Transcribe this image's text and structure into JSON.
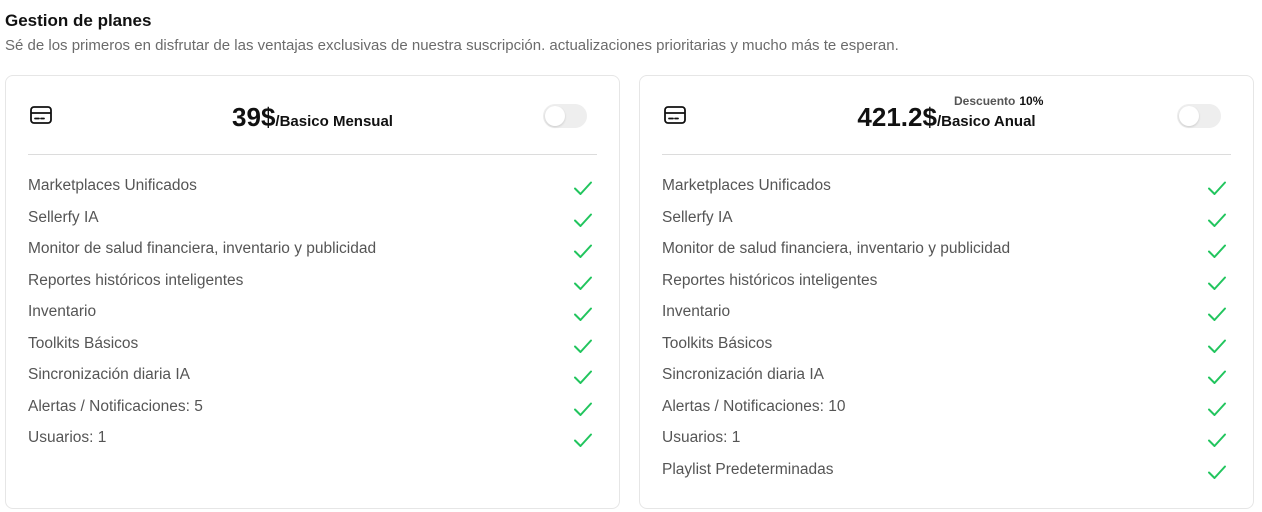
{
  "page": {
    "title": "Gestion de planes",
    "subtitle": "Sé de los primeros en disfrutar de las ventajas exclusivas de nuestra suscripción. actualizaciones prioritarias y mucho más te esperan."
  },
  "colors": {
    "check": "#22c55e",
    "toggle_off": "#eeeeee"
  },
  "plans": [
    {
      "icon": "credit-card-icon",
      "price": "39$",
      "period": "/Basico Mensual",
      "toggle_on": false,
      "features": [
        "Marketplaces Unificados",
        "Sellerfy IA",
        "Monitor de salud financiera, inventario y publicidad",
        "Reportes históricos inteligentes",
        "Inventario",
        "Toolkits Básicos",
        "Sincronización diaria IA",
        "Alertas / Notificaciones: 5",
        "Usuarios: 1"
      ]
    },
    {
      "icon": "credit-card-icon",
      "price": "421.2$",
      "period": "/Basico Anual",
      "discount_label": "Descuento",
      "discount_value": "10%",
      "toggle_on": false,
      "features": [
        "Marketplaces Unificados",
        "Sellerfy IA",
        "Monitor de salud financiera, inventario y publicidad",
        "Reportes históricos inteligentes",
        "Inventario",
        "Toolkits Básicos",
        "Sincronización diaria IA",
        "Alertas / Notificaciones: 10",
        "Usuarios: 1",
        "Playlist Predeterminadas"
      ]
    }
  ]
}
